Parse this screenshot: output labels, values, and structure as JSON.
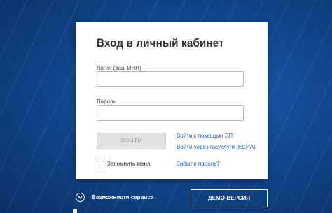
{
  "login_card": {
    "title": "Вход в личный кабинет",
    "login_label": "Логин (ваш ИНН)",
    "login_value": "",
    "password_label": "Пароль",
    "password_value": "",
    "submit_label": "ВОЙТИ",
    "ep_link": "Войти с помощью ЭП",
    "esia_link": "Войти через госуслуги (ЕСИА)",
    "remember_label": "Запомнить меня",
    "forgot_link": "Забыли пароль?"
  },
  "footer": {
    "features_label": "Возможности сервиса",
    "features_icon": "chevron-down-icon",
    "demo_button": "ДЕМО-ВЕРСИЯ"
  },
  "colors": {
    "background": "#12478f",
    "link": "#1f63c6",
    "button_disabled": "#e1e1e1"
  }
}
